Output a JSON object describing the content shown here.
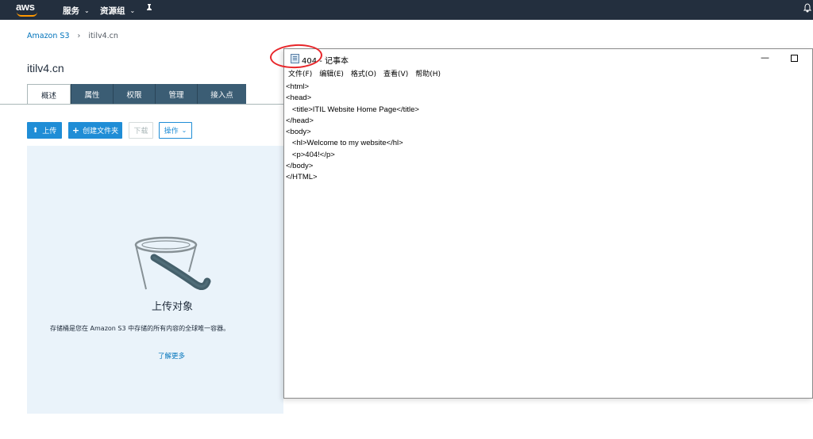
{
  "topnav": {
    "logo_text": "aws",
    "services_label": "服务",
    "resource_groups_label": "资源组",
    "caret": "⌄",
    "pin_icon": "pin-icon",
    "bell_icon": "bell-icon"
  },
  "breadcrumb": {
    "root": "Amazon S3",
    "separator": "›",
    "current": "itilv4.cn"
  },
  "bucket": {
    "title": "itilv4.cn"
  },
  "tabs": [
    {
      "label": "概述",
      "active": true
    },
    {
      "label": "属性",
      "active": false
    },
    {
      "label": "权限",
      "active": false
    },
    {
      "label": "管理",
      "active": false
    },
    {
      "label": "接入点",
      "active": false
    }
  ],
  "actions": {
    "upload_label": "上传",
    "upload_icon": "⬆",
    "create_folder_label": "创建文件夹",
    "create_folder_icon": "+",
    "download_label": "下载",
    "actions_label": "操作",
    "actions_caret": "⌄"
  },
  "empty_state": {
    "heading": "上传对象",
    "description": "存储桶是您在 Amazon S3 中存储的所有内容的全球唯一容器。",
    "learn_more": "了解更多"
  },
  "notepad": {
    "title": "404 - 记事本",
    "menu": [
      "文件(F)",
      "编辑(E)",
      "格式(O)",
      "查看(V)",
      "帮助(H)"
    ],
    "minimize_glyph": "—",
    "content_lines": [
      "<html>",
      "<head>",
      "   <title>ITIL Website Home Page</title>",
      "</head>",
      "<body>",
      "   <hl>Welcome to my website</hl>",
      "   <p>404!</p>",
      "</body>",
      "</HTML>"
    ]
  },
  "colors": {
    "nav_bg": "#232f3e",
    "tab_bg": "#3b5d74",
    "primary_button": "#1f8dd6",
    "panel_bg": "#eaf3fa",
    "annotation": "#e8262a",
    "aws_orange": "#ff9900"
  }
}
